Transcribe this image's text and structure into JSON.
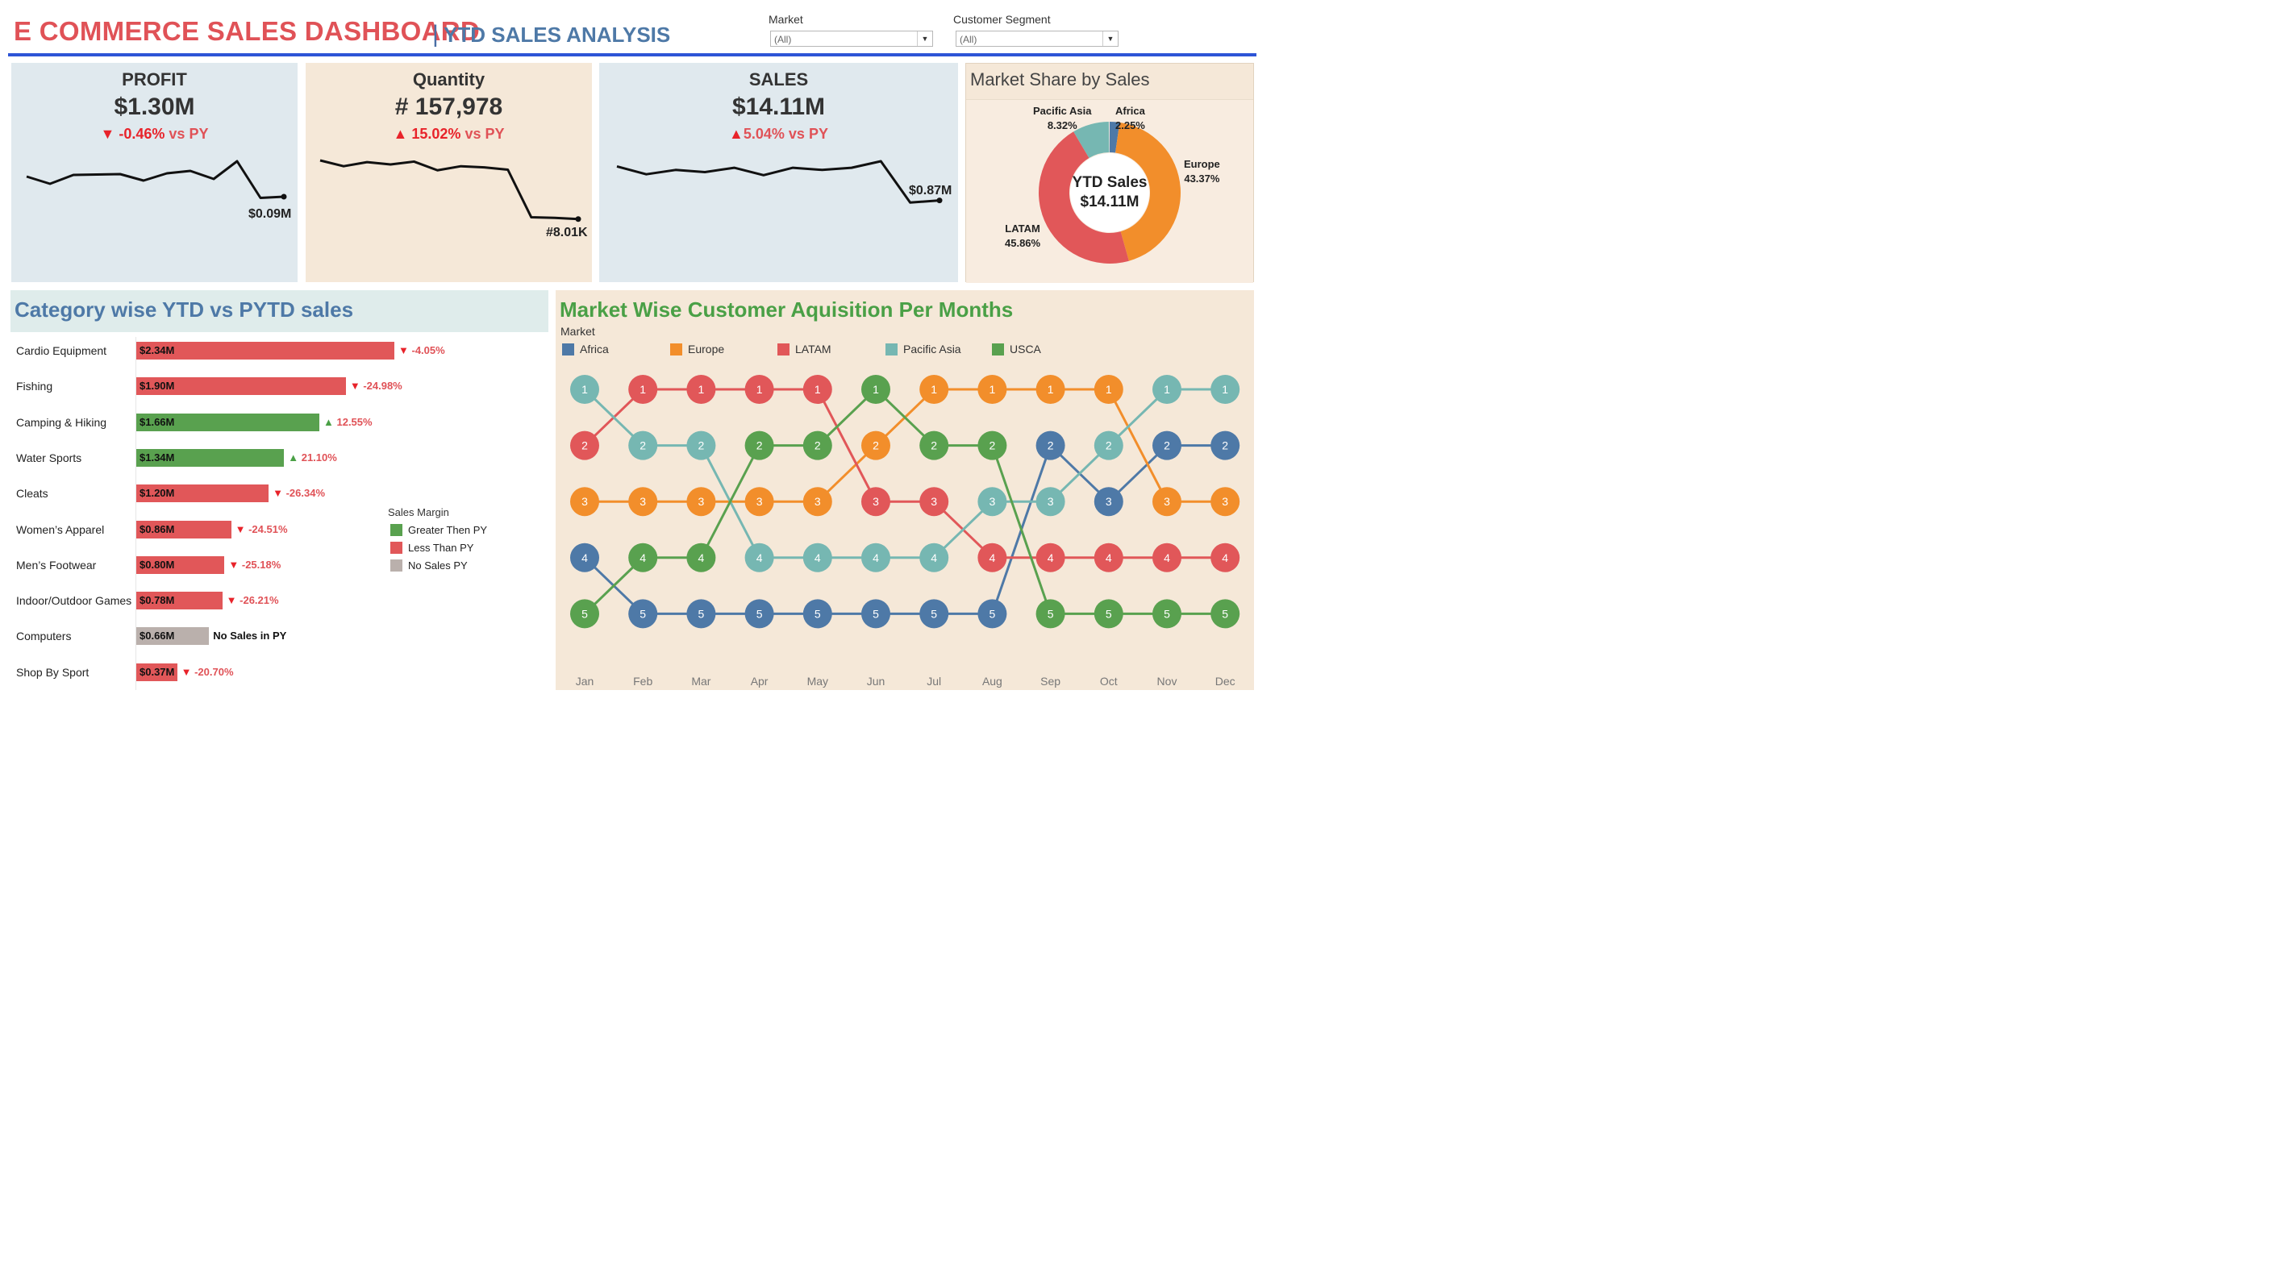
{
  "header": {
    "title": "E COMMERCE SALES DASHBOARD",
    "separator": "|",
    "subtitle": "YTD SALES ANALYSIS"
  },
  "filters": {
    "market": {
      "label": "Market",
      "value": "(All)"
    },
    "segment": {
      "label": "Customer Segment",
      "value": "(All)"
    }
  },
  "kpis": {
    "profit": {
      "title": "PROFIT",
      "value": "$1.30M",
      "arrow": "▼",
      "delta": "-0.46%",
      "vs": "vs PY",
      "end_label": "$0.09M",
      "bg": "#e0e9ee",
      "trend": [
        0.62,
        0.44,
        0.66,
        0.67,
        0.68,
        0.52,
        0.7,
        0.76,
        0.56,
        1.0,
        0.09,
        0.12
      ]
    },
    "quantity": {
      "title": "Quantity",
      "value": "# 157,978",
      "arrow": "▲",
      "delta": "15.02%",
      "vs": "vs PY",
      "end_label": "#8.01K",
      "bg": "#f5e8d8",
      "trend": [
        1.0,
        0.9,
        0.97,
        0.93,
        0.98,
        0.83,
        0.9,
        0.88,
        0.84,
        0.02,
        0.01,
        -0.01
      ]
    },
    "sales": {
      "title": "SALES",
      "value": "$14.11M",
      "arrow": "▲",
      "delta": "5.04%",
      "vs": "vs PY",
      "end_label": "$0.87M",
      "bg": "#e0e9ee",
      "trend": [
        0.88,
        0.7,
        0.8,
        0.75,
        0.85,
        0.68,
        0.85,
        0.8,
        0.85,
        1.0,
        0.05,
        0.1
      ]
    }
  },
  "market_share": {
    "title": "Market Share by Sales",
    "center_label": "YTD Sales",
    "center_value": "$14.11M",
    "slices": [
      {
        "name": "Africa",
        "pct": 2.25,
        "label": "2.25%",
        "color": "#4e79a7"
      },
      {
        "name": "Europe",
        "pct": 43.37,
        "label": "43.37%",
        "color": "#f28e2b"
      },
      {
        "name": "LATAM",
        "pct": 45.86,
        "label": "45.86%",
        "color": "#e15759"
      },
      {
        "name": "Pacific Asia",
        "pct": 8.32,
        "label": "8.32%",
        "color": "#76b7b2"
      }
    ]
  },
  "category": {
    "title": "Category wise YTD vs PYTD sales",
    "rows": [
      {
        "name": "Cardio Equipment",
        "value": 2.34,
        "label": "$2.34M",
        "status": "less",
        "arrow": "▼",
        "delta": "-4.05%"
      },
      {
        "name": "Fishing",
        "value": 1.9,
        "label": "$1.90M",
        "status": "less",
        "arrow": "▼",
        "delta": "-24.98%"
      },
      {
        "name": "Camping & Hiking",
        "value": 1.66,
        "label": "$1.66M",
        "status": "greater",
        "arrow": "▲",
        "delta": "12.55%"
      },
      {
        "name": "Water Sports",
        "value": 1.34,
        "label": "$1.34M",
        "status": "greater",
        "arrow": "▲",
        "delta": "21.10%"
      },
      {
        "name": "Cleats",
        "value": 1.2,
        "label": "$1.20M",
        "status": "less",
        "arrow": "▼",
        "delta": "-26.34%"
      },
      {
        "name": "Women’s Apparel",
        "value": 0.86,
        "label": "$0.86M",
        "status": "less",
        "arrow": "▼",
        "delta": "-24.51%"
      },
      {
        "name": "Men’s Footwear",
        "value": 0.8,
        "label": "$0.80M",
        "status": "less",
        "arrow": "▼",
        "delta": "-25.18%"
      },
      {
        "name": "Indoor/Outdoor Games",
        "value": 0.78,
        "label": "$0.78M",
        "status": "less",
        "arrow": "▼",
        "delta": "-26.21%"
      },
      {
        "name": "Computers",
        "value": 0.66,
        "label": "$0.66M",
        "status": "none",
        "arrow": "",
        "delta": "No Sales in PY"
      },
      {
        "name": "Shop By Sport",
        "value": 0.37,
        "label": "$0.37M",
        "status": "less",
        "arrow": "▼",
        "delta": "-20.70%"
      }
    ],
    "legend": {
      "title": "Sales Margin",
      "items": [
        {
          "key": "greater",
          "label": "Greater Then PY",
          "color": "#59a14f"
        },
        {
          "key": "less",
          "label": "Less Than PY",
          "color": "#e15759"
        },
        {
          "key": "none",
          "label": "No Sales PY",
          "color": "#bab0ac"
        }
      ]
    }
  },
  "bump": {
    "title": "Market Wise Customer Aquisition Per Months",
    "legend_title": "Market",
    "months": [
      "Jan",
      "Feb",
      "Mar",
      "Apr",
      "May",
      "Jun",
      "Jul",
      "Aug",
      "Sep",
      "Oct",
      "Nov",
      "Dec"
    ],
    "markets": [
      {
        "name": "Africa",
        "color": "#4e79a7",
        "ranks": [
          4,
          5,
          5,
          5,
          5,
          5,
          5,
          5,
          2,
          3,
          2,
          2
        ]
      },
      {
        "name": "Europe",
        "color": "#f28e2b",
        "ranks": [
          3,
          3,
          3,
          3,
          3,
          2,
          1,
          1,
          1,
          1,
          3,
          3
        ]
      },
      {
        "name": "LATAM",
        "color": "#e15759",
        "ranks": [
          2,
          1,
          1,
          1,
          1,
          3,
          3,
          4,
          4,
          4,
          4,
          4
        ]
      },
      {
        "name": "Pacific Asia",
        "color": "#76b7b2",
        "ranks": [
          1,
          2,
          2,
          4,
          4,
          4,
          4,
          3,
          3,
          2,
          1,
          1
        ]
      },
      {
        "name": "USCA",
        "color": "#59a14f",
        "ranks": [
          5,
          4,
          4,
          2,
          2,
          1,
          2,
          2,
          5,
          5,
          5,
          5
        ]
      }
    ]
  }
}
